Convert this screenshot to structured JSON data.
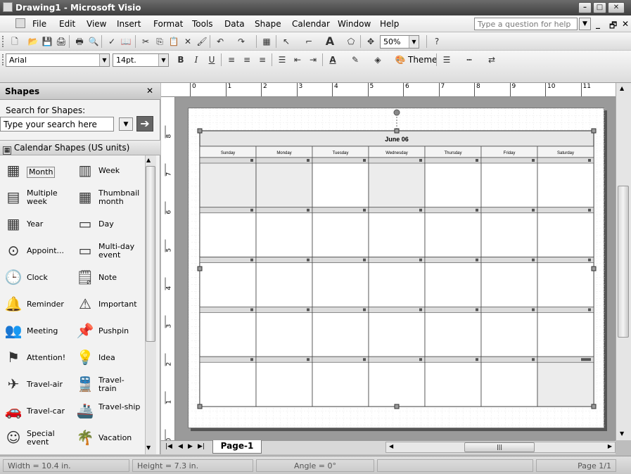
{
  "window": {
    "title": "Drawing1 - Microsoft Visio"
  },
  "menu": {
    "items": [
      "File",
      "Edit",
      "View",
      "Insert",
      "Format",
      "Tools",
      "Data",
      "Shape",
      "Calendar",
      "Window",
      "Help"
    ],
    "help_placeholder": "Type a question for help"
  },
  "toolbar": {
    "zoom": "50%",
    "theme_label": "Theme",
    "font": "Arial",
    "font_size": "14pt."
  },
  "shapes_panel": {
    "title": "Shapes",
    "search_label": "Search for Shapes:",
    "search_placeholder": "Type your search here",
    "stencil": "Calendar Shapes (US units)",
    "items": [
      {
        "label": "Month",
        "icon": "month-icon"
      },
      {
        "label": "Week",
        "icon": "week-icon"
      },
      {
        "label": "Multiple week",
        "icon": "multiple-week-icon"
      },
      {
        "label": "Thumbnail month",
        "icon": "thumbnail-month-icon"
      },
      {
        "label": "Year",
        "icon": "year-icon"
      },
      {
        "label": "Day",
        "icon": "day-icon"
      },
      {
        "label": "Appoint...",
        "icon": "appointment-icon"
      },
      {
        "label": "Multi-day event",
        "icon": "multi-day-event-icon"
      },
      {
        "label": "Clock",
        "icon": "clock-icon"
      },
      {
        "label": "Note",
        "icon": "note-icon"
      },
      {
        "label": "Reminder",
        "icon": "bell-icon"
      },
      {
        "label": "Important",
        "icon": "warning-icon"
      },
      {
        "label": "Meeting",
        "icon": "meeting-icon"
      },
      {
        "label": "Pushpin",
        "icon": "pushpin-icon"
      },
      {
        "label": "Attention!",
        "icon": "flag-icon"
      },
      {
        "label": "Idea",
        "icon": "lightbulb-icon"
      },
      {
        "label": "Travel-air",
        "icon": "airplane-icon"
      },
      {
        "label": "Travel-train",
        "icon": "train-icon"
      },
      {
        "label": "Travel-car",
        "icon": "car-icon"
      },
      {
        "label": "Travel-ship",
        "icon": "ship-icon"
      },
      {
        "label": "Special event",
        "icon": "smiley-icon"
      },
      {
        "label": "Vacation",
        "icon": "palm-tree-icon"
      }
    ]
  },
  "calendar": {
    "title": "June 06",
    "days": [
      "Sunday",
      "Monday",
      "Tuesday",
      "Wednesday",
      "Thursday",
      "Friday",
      "Saturday"
    ]
  },
  "rulers": {
    "top": [
      "0",
      "1",
      "2",
      "3",
      "4",
      "5",
      "6",
      "7",
      "8",
      "9",
      "10",
      "11"
    ],
    "left": [
      "8",
      "7",
      "6",
      "5",
      "4",
      "3",
      "2",
      "1",
      "0"
    ]
  },
  "page_tab": "Page-1",
  "status": {
    "width": "Width = 10.4 in.",
    "height": "Height = 7.3 in.",
    "angle": "Angle = 0°",
    "page": "Page 1/1"
  }
}
